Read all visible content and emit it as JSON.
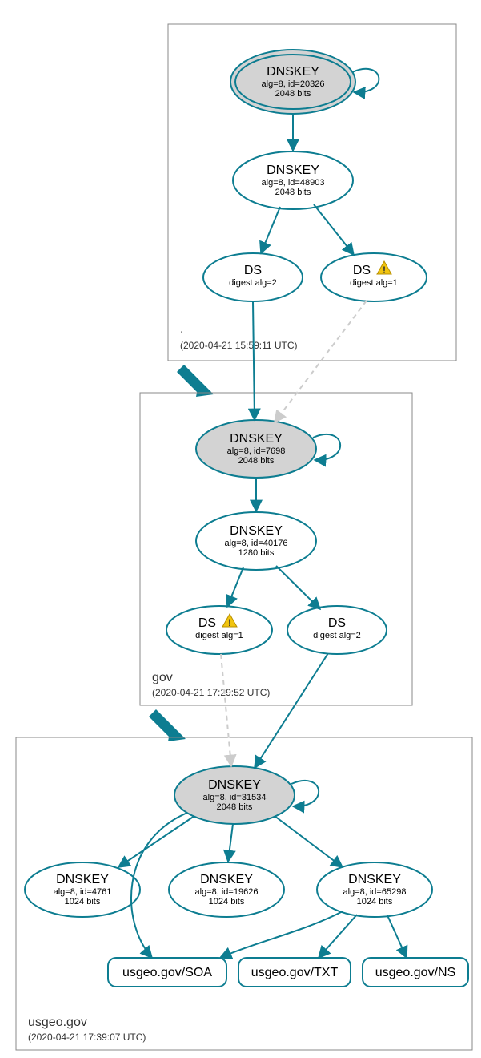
{
  "zones": {
    "root": {
      "name": ".",
      "timestamp": "(2020-04-21 15:59:11 UTC)"
    },
    "gov": {
      "name": "gov",
      "timestamp": "(2020-04-21 17:29:52 UTC)"
    },
    "usgeo": {
      "name": "usgeo.gov",
      "timestamp": "(2020-04-21 17:39:07 UTC)"
    }
  },
  "nodes": {
    "root_ksk": {
      "title": "DNSKEY",
      "line1": "alg=8, id=20326",
      "line2": "2048 bits"
    },
    "root_zsk": {
      "title": "DNSKEY",
      "line1": "alg=8, id=48903",
      "line2": "2048 bits"
    },
    "root_ds2": {
      "title": "DS",
      "line1": "digest alg=2"
    },
    "root_ds1": {
      "title": "DS",
      "line1": "digest alg=1"
    },
    "gov_ksk": {
      "title": "DNSKEY",
      "line1": "alg=8, id=7698",
      "line2": "2048 bits"
    },
    "gov_zsk": {
      "title": "DNSKEY",
      "line1": "alg=8, id=40176",
      "line2": "1280 bits"
    },
    "gov_ds1": {
      "title": "DS",
      "line1": "digest alg=1"
    },
    "gov_ds2": {
      "title": "DS",
      "line1": "digest alg=2"
    },
    "usgeo_ksk": {
      "title": "DNSKEY",
      "line1": "alg=8, id=31534",
      "line2": "2048 bits"
    },
    "usgeo_k1": {
      "title": "DNSKEY",
      "line1": "alg=8, id=4761",
      "line2": "1024 bits"
    },
    "usgeo_k2": {
      "title": "DNSKEY",
      "line1": "alg=8, id=19626",
      "line2": "1024 bits"
    },
    "usgeo_k3": {
      "title": "DNSKEY",
      "line1": "alg=8, id=65298",
      "line2": "1024 bits"
    },
    "rr_soa": {
      "label": "usgeo.gov/SOA"
    },
    "rr_txt": {
      "label": "usgeo.gov/TXT"
    },
    "rr_ns": {
      "label": "usgeo.gov/NS"
    }
  },
  "warning_glyph": "!",
  "chart_data": {
    "type": "graph",
    "description": "DNSSEC authentication chain diagram",
    "zones": [
      {
        "id": "root",
        "label": ".",
        "timestamp_utc": "2020-04-21 15:59:11"
      },
      {
        "id": "gov",
        "label": "gov",
        "timestamp_utc": "2020-04-21 17:29:52"
      },
      {
        "id": "usgeo",
        "label": "usgeo.gov",
        "timestamp_utc": "2020-04-21 17:39:07"
      }
    ],
    "nodes": [
      {
        "id": "root_ksk",
        "zone": "root",
        "type": "DNSKEY",
        "alg": 8,
        "key_id": 20326,
        "bits": 2048,
        "ksk": true,
        "trust_anchor": true
      },
      {
        "id": "root_zsk",
        "zone": "root",
        "type": "DNSKEY",
        "alg": 8,
        "key_id": 48903,
        "bits": 2048,
        "ksk": false
      },
      {
        "id": "root_ds2",
        "zone": "root",
        "type": "DS",
        "digest_alg": 2
      },
      {
        "id": "root_ds1",
        "zone": "root",
        "type": "DS",
        "digest_alg": 1,
        "warning": true
      },
      {
        "id": "gov_ksk",
        "zone": "gov",
        "type": "DNSKEY",
        "alg": 8,
        "key_id": 7698,
        "bits": 2048,
        "ksk": true
      },
      {
        "id": "gov_zsk",
        "zone": "gov",
        "type": "DNSKEY",
        "alg": 8,
        "key_id": 40176,
        "bits": 1280,
        "ksk": false
      },
      {
        "id": "gov_ds1",
        "zone": "gov",
        "type": "DS",
        "digest_alg": 1,
        "warning": true
      },
      {
        "id": "gov_ds2",
        "zone": "gov",
        "type": "DS",
        "digest_alg": 2
      },
      {
        "id": "usgeo_ksk",
        "zone": "usgeo",
        "type": "DNSKEY",
        "alg": 8,
        "key_id": 31534,
        "bits": 2048,
        "ksk": true
      },
      {
        "id": "usgeo_k1",
        "zone": "usgeo",
        "type": "DNSKEY",
        "alg": 8,
        "key_id": 4761,
        "bits": 1024,
        "ksk": false
      },
      {
        "id": "usgeo_k2",
        "zone": "usgeo",
        "type": "DNSKEY",
        "alg": 8,
        "key_id": 19626,
        "bits": 1024,
        "ksk": false
      },
      {
        "id": "usgeo_k3",
        "zone": "usgeo",
        "type": "DNSKEY",
        "alg": 8,
        "key_id": 65298,
        "bits": 1024,
        "ksk": false
      },
      {
        "id": "rr_soa",
        "zone": "usgeo",
        "type": "RRset",
        "name": "usgeo.gov",
        "rrtype": "SOA"
      },
      {
        "id": "rr_txt",
        "zone": "usgeo",
        "type": "RRset",
        "name": "usgeo.gov",
        "rrtype": "TXT"
      },
      {
        "id": "rr_ns",
        "zone": "usgeo",
        "type": "RRset",
        "name": "usgeo.gov",
        "rrtype": "NS"
      }
    ],
    "edges": [
      {
        "from": "root_ksk",
        "to": "root_ksk",
        "style": "solid",
        "kind": "self-sign"
      },
      {
        "from": "root_ksk",
        "to": "root_zsk",
        "style": "solid",
        "kind": "signs"
      },
      {
        "from": "root_zsk",
        "to": "root_ds2",
        "style": "solid",
        "kind": "signs"
      },
      {
        "from": "root_zsk",
        "to": "root_ds1",
        "style": "solid",
        "kind": "signs"
      },
      {
        "from": "root_ds2",
        "to": "gov_ksk",
        "style": "solid",
        "kind": "delegation"
      },
      {
        "from": "root_ds1",
        "to": "gov_ksk",
        "style": "dashed",
        "kind": "delegation-insecure"
      },
      {
        "from": "gov_ksk",
        "to": "gov_ksk",
        "style": "solid",
        "kind": "self-sign"
      },
      {
        "from": "gov_ksk",
        "to": "gov_zsk",
        "style": "solid",
        "kind": "signs"
      },
      {
        "from": "gov_zsk",
        "to": "gov_ds1",
        "style": "solid",
        "kind": "signs"
      },
      {
        "from": "gov_zsk",
        "to": "gov_ds2",
        "style": "solid",
        "kind": "signs"
      },
      {
        "from": "gov_ds1",
        "to": "usgeo_ksk",
        "style": "dashed",
        "kind": "delegation-insecure"
      },
      {
        "from": "gov_ds2",
        "to": "usgeo_ksk",
        "style": "solid",
        "kind": "delegation"
      },
      {
        "from": "usgeo_ksk",
        "to": "usgeo_ksk",
        "style": "solid",
        "kind": "self-sign"
      },
      {
        "from": "usgeo_ksk",
        "to": "usgeo_k1",
        "style": "solid",
        "kind": "signs"
      },
      {
        "from": "usgeo_ksk",
        "to": "usgeo_k2",
        "style": "solid",
        "kind": "signs"
      },
      {
        "from": "usgeo_ksk",
        "to": "usgeo_k3",
        "style": "solid",
        "kind": "signs"
      },
      {
        "from": "usgeo_k3",
        "to": "rr_soa",
        "style": "solid",
        "kind": "signs"
      },
      {
        "from": "usgeo_k3",
        "to": "rr_txt",
        "style": "solid",
        "kind": "signs"
      },
      {
        "from": "usgeo_k3",
        "to": "rr_ns",
        "style": "solid",
        "kind": "signs"
      },
      {
        "from": "usgeo_ksk",
        "to": "rr_soa",
        "style": "solid",
        "kind": "signs"
      }
    ],
    "zone_order": [
      {
        "from": "root",
        "to": "gov"
      },
      {
        "from": "gov",
        "to": "usgeo"
      }
    ]
  }
}
